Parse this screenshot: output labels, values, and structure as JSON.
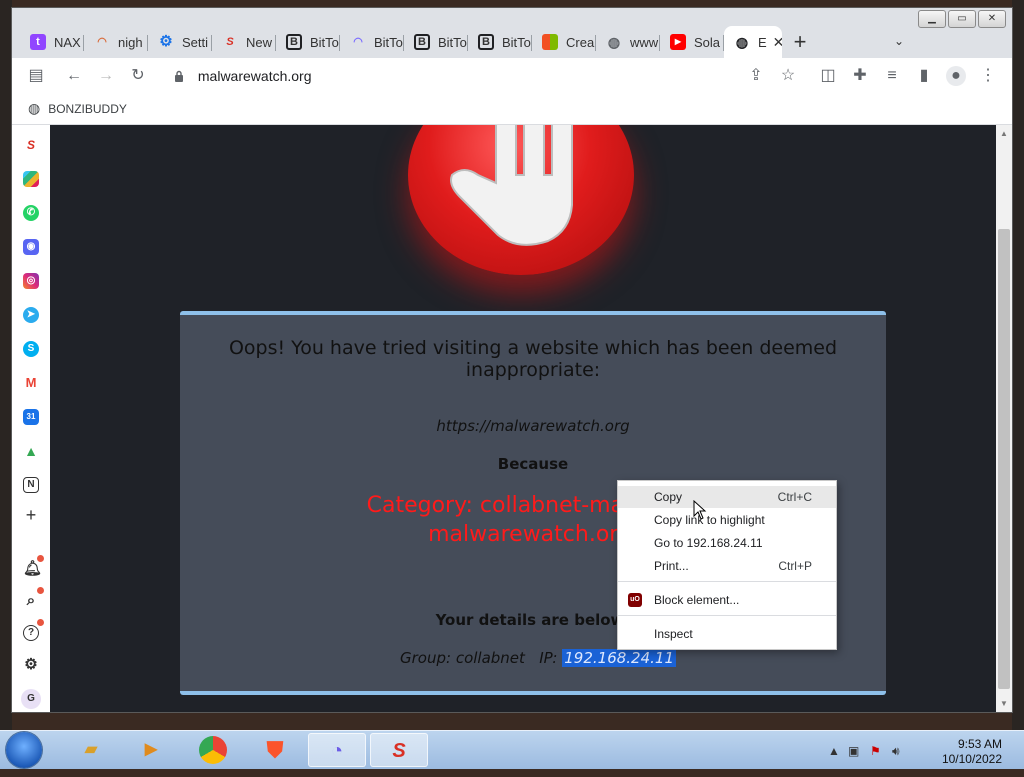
{
  "browser": {
    "tabs": [
      {
        "label": "NAX",
        "icon": "twitch-icon",
        "color": "#9146ff"
      },
      {
        "label": "nigh",
        "icon": "rainbow-icon",
        "color": "#d96b3b"
      },
      {
        "label": "Setti",
        "icon": "gear-icon",
        "color": "#1a73e8"
      },
      {
        "label": "New",
        "icon": "s-logo-icon",
        "color": "#d93025"
      },
      {
        "label": "BitTo",
        "icon": "b-logo-icon",
        "color": "#202124"
      },
      {
        "label": "BitTo",
        "icon": "bittorrent-icon",
        "color": "#7b6cff"
      },
      {
        "label": "BitTo",
        "icon": "b-logo-icon",
        "color": "#202124"
      },
      {
        "label": "BitTo",
        "icon": "b-logo-icon",
        "color": "#202124"
      },
      {
        "label": "Crea",
        "icon": "microsoft-icon",
        "color": "#f25022"
      },
      {
        "label": "www",
        "icon": "globe-icon",
        "color": "#5f6368"
      },
      {
        "label": "Sola",
        "icon": "youtube-icon",
        "color": "#ff0000"
      }
    ],
    "active_tab": {
      "label": "E",
      "icon": "globe-icon",
      "close": "✕"
    },
    "new_tab": "+",
    "address": "malwarewatch.org",
    "bookmark": "BONZIBUDDY"
  },
  "page": {
    "headline": "Oops! You have tried visiting a website which has been deemed inappropriate:",
    "url": "https://malwarewatch.org",
    "because": "Because",
    "category_line1": "Category: collabnet-malicious",
    "category_line2": "malwarewatch.org",
    "details": "Your details are below:",
    "group_label": "Group: collabnet   IP: ",
    "ip": "192.168.24.11"
  },
  "context_menu": {
    "items": [
      {
        "label": "Copy",
        "shortcut": "Ctrl+C"
      },
      {
        "label": "Copy link to highlight",
        "shortcut": ""
      },
      {
        "label": "Go to 192.168.24.11",
        "shortcut": ""
      },
      {
        "label": "Print...",
        "shortcut": "Ctrl+P"
      },
      {
        "label": "Block element...",
        "shortcut": ""
      },
      {
        "label": "Inspect",
        "shortcut": ""
      }
    ],
    "ublock_badge": "uO"
  },
  "sidebar": {
    "profile_letter": "G",
    "add": "+"
  },
  "taskbar": {
    "time": "9:53 AM",
    "date": "10/10/2022"
  },
  "colors": {
    "accent": "#1a73e8",
    "blocked_red": "#ff1a1a",
    "panel_border": "#8ec0ea",
    "selection": "#1a62d6"
  }
}
